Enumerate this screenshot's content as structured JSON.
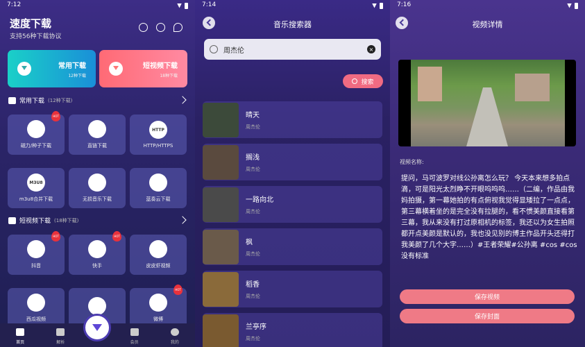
{
  "panel1": {
    "time": "7:12",
    "title": "速度下载",
    "subtitle": "支持56种下载协议",
    "header_icons": [
      "settings-icon",
      "help-icon",
      "search-icon"
    ],
    "btn_common": {
      "title": "常用下载",
      "sub": "12种下载"
    },
    "btn_short": {
      "title": "短视频下载",
      "sub": "18种下载"
    },
    "sec1": {
      "title": "常用下载",
      "count": "(12种下载)"
    },
    "sec1_items": [
      {
        "label": "磁力/种子下载",
        "icon": "cup-icon",
        "hot": "HOT"
      },
      {
        "label": "直链下载",
        "icon": "link-icon"
      },
      {
        "label": "HTTP/HTTPS",
        "icon": "http-icon",
        "glyph": "HTTP"
      },
      {
        "label": "m3u8合并下载",
        "icon": "m3u8-icon",
        "glyph": "M3U8"
      },
      {
        "label": "无损音乐下载",
        "icon": "music-icon"
      },
      {
        "label": "蓝奏云下载",
        "icon": "cloud-icon"
      }
    ],
    "sec2": {
      "title": "短视频下载",
      "count": "(18种下载)"
    },
    "sec2_items": [
      {
        "label": "抖音",
        "icon": "douyin-icon",
        "hot": "HOT"
      },
      {
        "label": "快手",
        "icon": "kuaishou-icon",
        "hot": "HOT"
      },
      {
        "label": "皮皮虾视频",
        "icon": "play-icon"
      },
      {
        "label": "西瓜视频",
        "icon": "xigua-icon"
      },
      {
        "label": "",
        "icon": "app-icon"
      },
      {
        "label": "微博",
        "icon": "weibo-icon",
        "hot": "HOT"
      }
    ],
    "nav": [
      {
        "label": "首页",
        "icon": "home-icon"
      },
      {
        "label": "解析",
        "icon": "folder-icon"
      },
      {
        "label": "会员",
        "icon": "video-icon"
      },
      {
        "label": "我的",
        "icon": "user-icon"
      }
    ]
  },
  "panel2": {
    "time": "7:14",
    "title": "音乐搜索器",
    "query": "周杰伦",
    "search_label": "搜索",
    "songs": [
      {
        "name": "晴天",
        "artist": "周杰伦",
        "color": "#3c4a3a"
      },
      {
        "name": "搁浅",
        "artist": "周杰伦",
        "color": "#5a4a3e"
      },
      {
        "name": "一路向北",
        "artist": "周杰伦",
        "color": "#4a4a4a"
      },
      {
        "name": "枫",
        "artist": "周杰伦",
        "color": "#6a5a4a"
      },
      {
        "name": "稻香",
        "artist": "周杰伦",
        "color": "#8a6a3a"
      },
      {
        "name": "兰亭序",
        "artist": "周杰伦",
        "color": "#7a5a30"
      }
    ]
  },
  "panel3": {
    "time": "7:16",
    "title": "视频详情",
    "label": "视频名称:",
    "description": "提问，马可波罗对线公孙离怎么玩？ 今天本来想多拍点滴，可是阳光太烈睁不开眼呜呜呜……（二编，作品由我妈拍摄，第一幕她拍的有点俯视我觉得显矮拉了一点点，第三幕横着坐的是完全没有拉腿的，看不惯美颜直接看第三幕，我从来没有打过原相机的标签，我还以为女生拍照都开点美颜是默认的，我也没见别的博主作品开头还得打我美颜了几个大字……）#王者荣耀#公孙离 #cos #cos没有标准",
    "save_video": "保存视频",
    "save_cover": "保存封面"
  }
}
